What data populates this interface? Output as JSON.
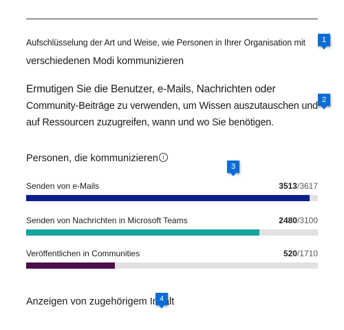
{
  "description_1": {
    "line1": "Aufschlüsselung der Art und Weise, wie Personen in Ihrer Organisation mit",
    "line2": "verschiedenen Modi kommunizieren"
  },
  "description_2": {
    "line1": "Ermutigen Sie die Benutzer, e-Mails, Nachrichten oder",
    "line2": "Community-Beiträge zu verwenden, um Wissen auszutauschen und",
    "line3": "auf Ressourcen zuzugreifen, wann und wo Sie benötigen."
  },
  "section_title": "Personen, die kommunizieren",
  "metrics": [
    {
      "label": "Senden von e-Mails",
      "value": "3513",
      "total": "/3617",
      "fraction": 0.971,
      "color": "#0d1e8c"
    },
    {
      "label": "Senden von Nachrichten in Microsoft Teams",
      "value": "2480",
      "total": "/3100",
      "fraction": 0.8,
      "color": "#17a3a0"
    },
    {
      "label": "Veröffentlichen in Communities",
      "value": "520",
      "total": "/1710",
      "fraction": 0.304,
      "color": "#4a0e4a"
    }
  ],
  "related_link": "Anzeigen von zugehörigem Inhalt",
  "callouts": [
    "1",
    "2",
    "3",
    "4"
  ],
  "colors": {
    "callout": "#0b6cd6",
    "track": "#e1e1e1"
  },
  "icons": {
    "info": "info-icon"
  }
}
